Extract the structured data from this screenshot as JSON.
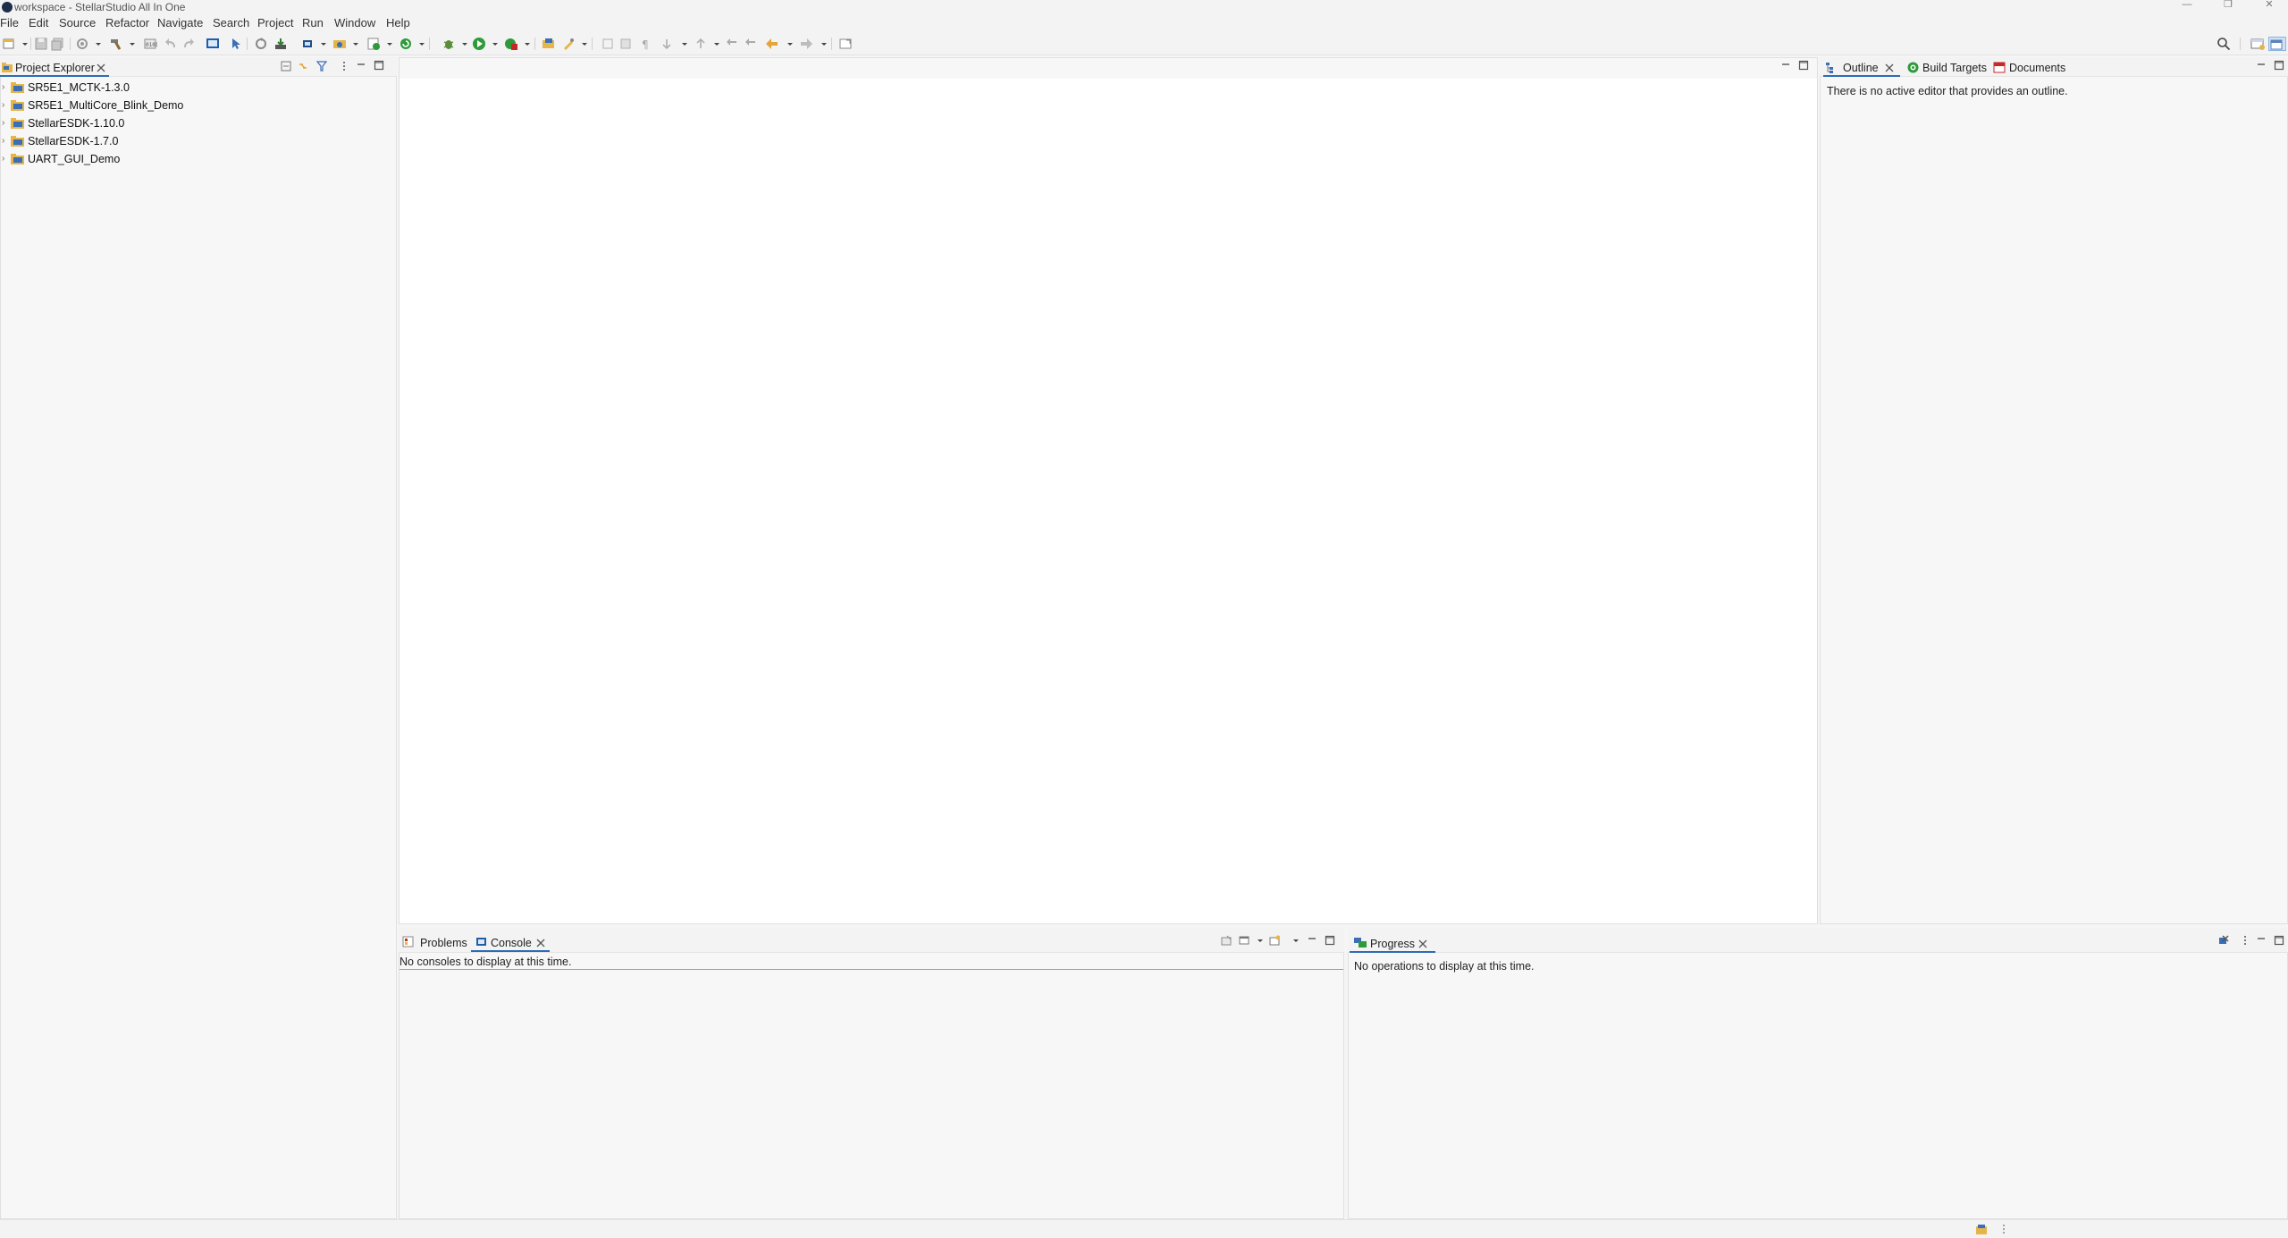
{
  "window": {
    "title": "workspace - StellarStudio All In One"
  },
  "menu": [
    "File",
    "Edit",
    "Source",
    "Refactor",
    "Navigate",
    "Search",
    "Project",
    "Run",
    "Window",
    "Help"
  ],
  "project_explorer": {
    "tab_label": "Project Explorer",
    "projects": [
      {
        "label": "SR5E1_MCTK-1.3.0"
      },
      {
        "label": "SR5E1_MultiCore_Blink_Demo"
      },
      {
        "label": "StellarESDK-1.10.0"
      },
      {
        "label": "StellarESDK-1.7.0"
      },
      {
        "label": "UART_GUI_Demo"
      }
    ]
  },
  "outline_panel": {
    "tabs": [
      "Outline",
      "Build Targets",
      "Documents"
    ],
    "message": "There is no active editor that provides an outline."
  },
  "console_panel": {
    "tabs": [
      "Problems",
      "Console"
    ],
    "message": "No consoles to display at this time."
  },
  "progress_panel": {
    "tab_label": "Progress",
    "message": "No operations to display at this time."
  },
  "colors": {
    "accent": "#2c6bb8",
    "background": "#f5f5f5",
    "run_green": "#2e9a3a"
  },
  "icons": {
    "close": "close-icon",
    "minimize": "minimize-icon",
    "maximize": "maximize-icon",
    "search": "search-icon",
    "project_folder": "project-folder-icon"
  }
}
